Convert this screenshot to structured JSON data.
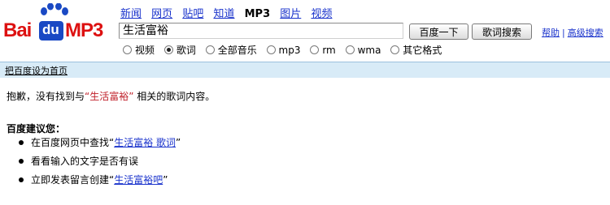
{
  "logo": {
    "bai": "Bai",
    "du": "du",
    "mp3": "MP3",
    "paw_color": "#1a49c4",
    "text_color": "#dd1111"
  },
  "nav": {
    "items": [
      {
        "label": "新闻",
        "link": true
      },
      {
        "label": "网页",
        "link": true
      },
      {
        "label": "贴吧",
        "link": true
      },
      {
        "label": "知道",
        "link": true
      },
      {
        "label": "MP3",
        "link": false
      },
      {
        "label": "图片",
        "link": true
      },
      {
        "label": "视频",
        "link": true
      }
    ]
  },
  "search": {
    "value": "生活富裕",
    "button_search": "百度一下",
    "button_lyrics": "歌词搜索"
  },
  "help": {
    "help_label": "帮助",
    "separator": "|",
    "advanced_label": "高级搜索"
  },
  "filters": {
    "options": [
      {
        "label": "视频",
        "selected": false
      },
      {
        "label": "歌词",
        "selected": true
      },
      {
        "label": "全部音乐",
        "selected": false
      },
      {
        "label": "mp3",
        "selected": false
      },
      {
        "label": "rm",
        "selected": false
      },
      {
        "label": "wma",
        "selected": false
      },
      {
        "label": "其它格式",
        "selected": false
      }
    ]
  },
  "band": {
    "set_homepage": "把百度设为首页"
  },
  "result": {
    "prefix": "抱歉，没有找到与",
    "query_quoted": "“生活富裕”",
    "suffix": " 相关的歌词内容。"
  },
  "suggestions": {
    "title": "百度建议您：",
    "items": [
      {
        "prefix": "在百度网页中查找“",
        "link": "生活富裕 歌词",
        "suffix": "”"
      },
      {
        "prefix": "看看输入的文字是否有误",
        "link": "",
        "suffix": ""
      },
      {
        "prefix": "立即发表留言创建“",
        "link": "生活富裕吧",
        "suffix": "”"
      }
    ]
  }
}
